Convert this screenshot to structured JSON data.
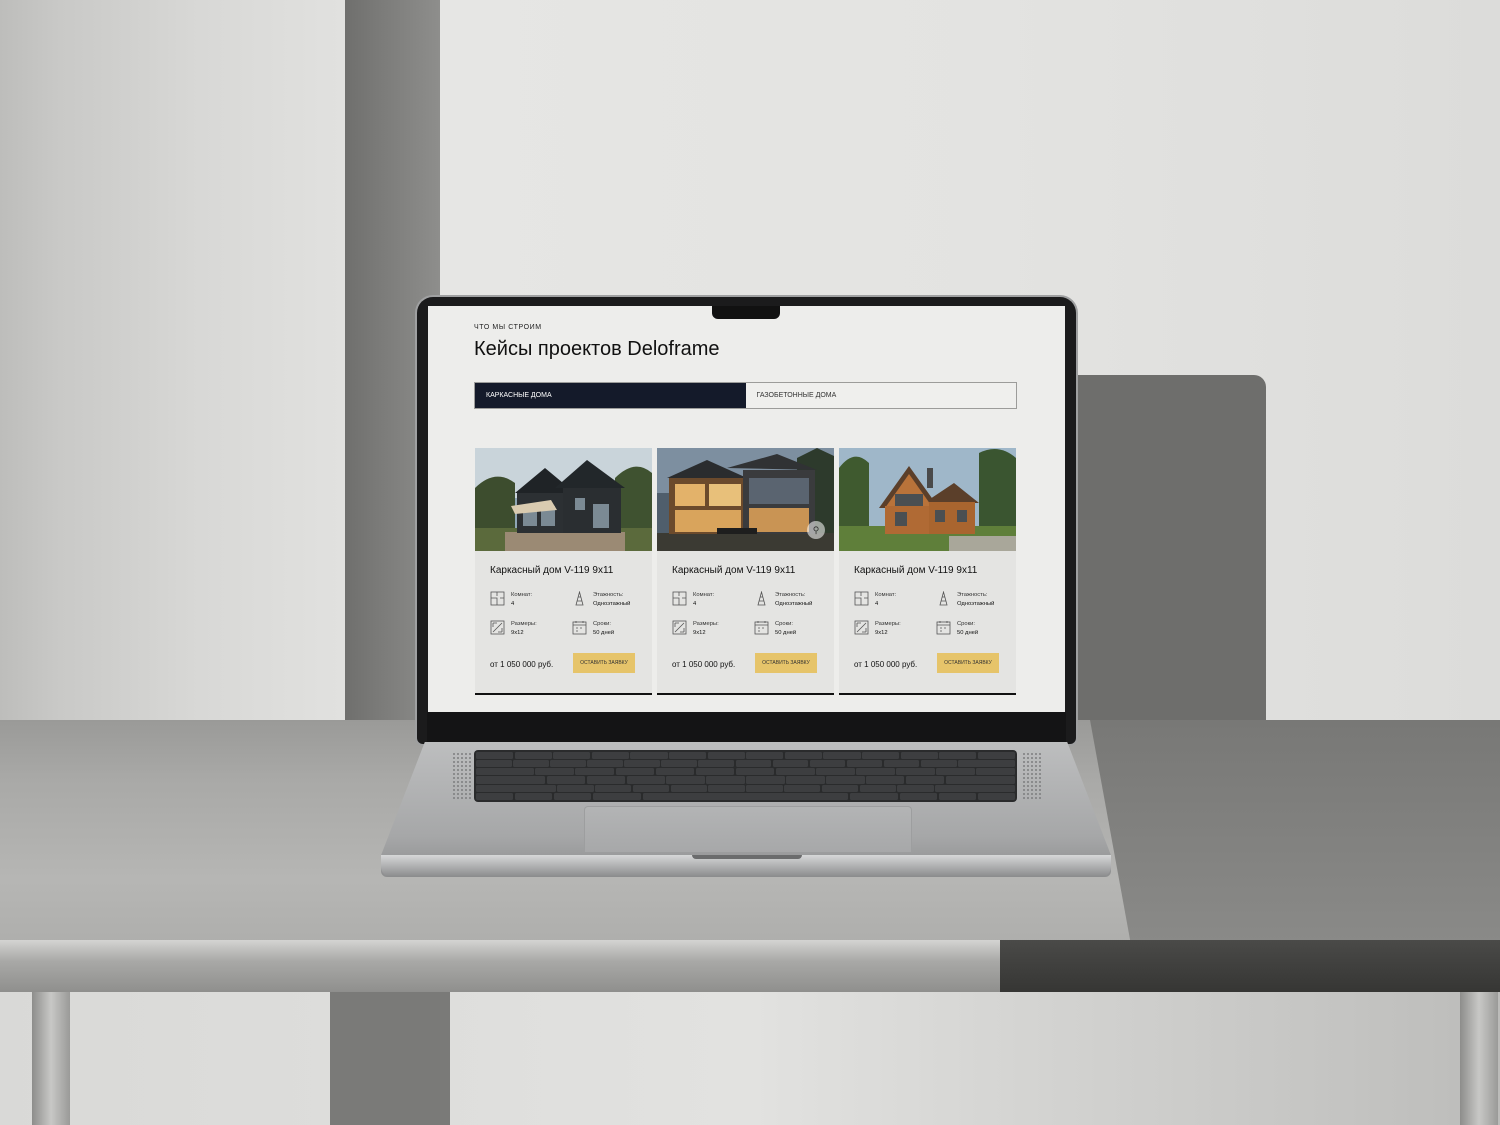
{
  "section": {
    "eyebrow": "Что мы строим",
    "title": "Кейсы проектов Deloframe"
  },
  "tabs": [
    {
      "label": "Каркасные дома",
      "active": true
    },
    {
      "label": "Газобетонные дома",
      "active": false
    }
  ],
  "cards": [
    {
      "title": "Каркасный дом V-119 9x11",
      "rooms_label": "Комнат:",
      "rooms_value": "4",
      "floors_label": "Этажность:",
      "floors_value": "Одноэтажный",
      "size_label": "Размеры:",
      "size_value": "9x12",
      "term_label": "Сроки:",
      "term_value": "50 дней",
      "price": "от 1 050 000 руб.",
      "button": "Оставить заявку",
      "photo_icon": "dark-frame-house-photo"
    },
    {
      "title": "Каркасный дом V-119 9x11",
      "rooms_label": "Комнат:",
      "rooms_value": "4",
      "floors_label": "Этажность:",
      "floors_value": "Одноэтажный",
      "size_label": "Размеры:",
      "size_value": "9x12",
      "term_label": "Сроки:",
      "term_value": "50 дней",
      "price": "от 1 050 000 руб.",
      "button": "Оставить заявку",
      "photo_icon": "modern-glass-house-photo"
    },
    {
      "title": "Каркасный дом V-119 9x11",
      "rooms_label": "Комнат:",
      "rooms_value": "4",
      "floors_label": "Этажность:",
      "floors_value": "Одноэтажный",
      "size_label": "Размеры:",
      "size_value": "9x12",
      "term_label": "Сроки:",
      "term_value": "50 дней",
      "price": "от 1 050 000 руб.",
      "button": "Оставить заявку",
      "photo_icon": "wooden-house-photo"
    }
  ],
  "colors": {
    "tab_active_bg": "#141a2a",
    "button_bg": "#e6c46a",
    "card_bg": "#e4e4e2"
  }
}
